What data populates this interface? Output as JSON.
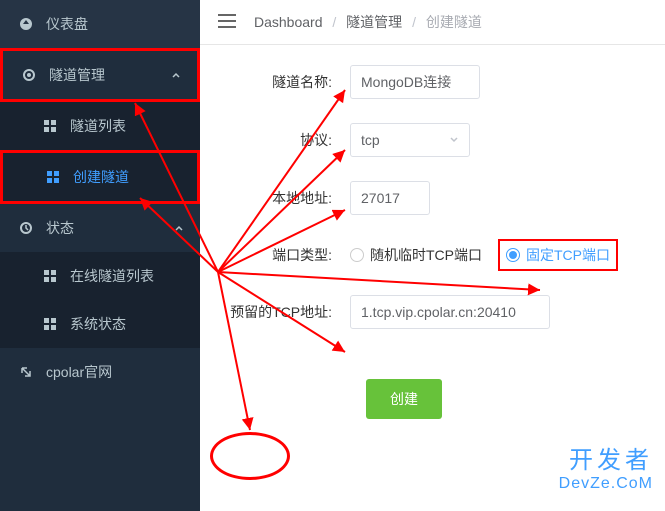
{
  "sidebar": {
    "items": [
      {
        "label": "仪表盘",
        "icon": "dashboard"
      },
      {
        "label": "隧道管理",
        "icon": "settings"
      },
      {
        "label": "隧道列表",
        "icon": "grid"
      },
      {
        "label": "创建隧道",
        "icon": "grid"
      },
      {
        "label": "状态",
        "icon": "status"
      },
      {
        "label": "在线隧道列表",
        "icon": "grid"
      },
      {
        "label": "系统状态",
        "icon": "grid"
      },
      {
        "label": "cpolar官网",
        "icon": "external"
      }
    ]
  },
  "breadcrumbs": {
    "a": "Dashboard",
    "b": "隧道管理",
    "c": "创建隧道"
  },
  "form": {
    "name_label": "隧道名称:",
    "name_value": "MongoDB连接",
    "proto_label": "协议:",
    "proto_value": "tcp",
    "localaddr_label": "本地地址:",
    "localaddr_value": "27017",
    "porttype_label": "端口类型:",
    "porttype_opt1": "随机临时TCP端口",
    "porttype_opt2": "固定TCP端口",
    "reserved_label": "预留的TCP地址:",
    "reserved_value": "1.tcp.vip.cpolar.cn:20410",
    "create_btn": "创建"
  },
  "watermark": {
    "line1": "开发者",
    "line2": "DevZe.CoM"
  }
}
